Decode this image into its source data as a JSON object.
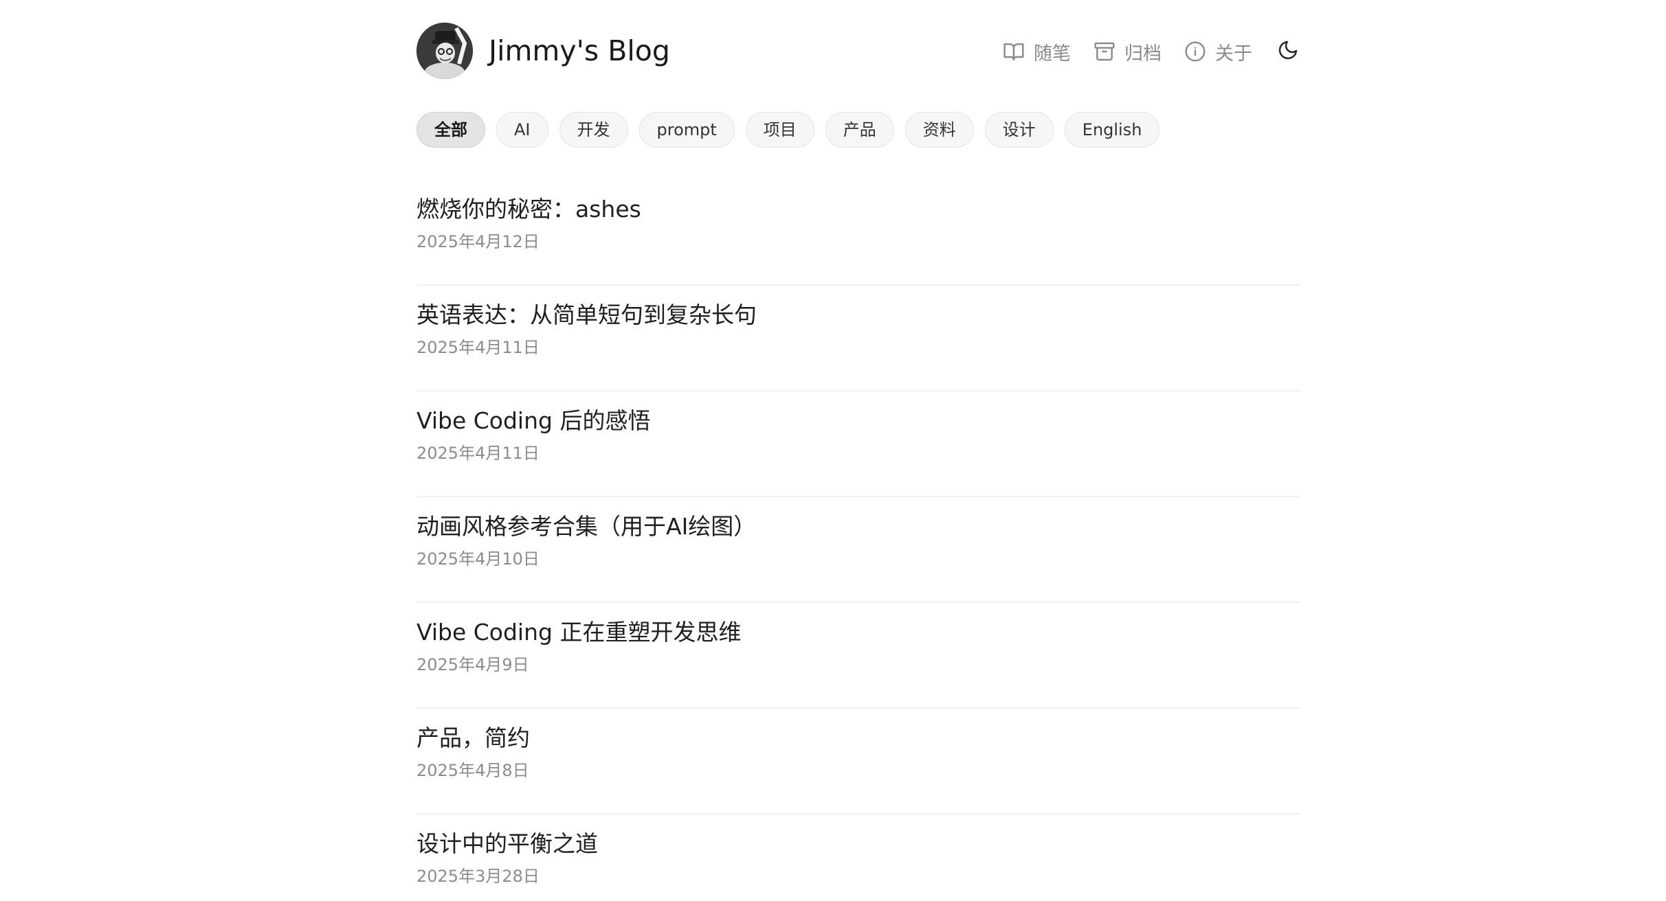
{
  "site": {
    "title": "Jimmy's Blog"
  },
  "nav": {
    "items": [
      {
        "label": "随笔",
        "icon": "book-open-icon"
      },
      {
        "label": "归档",
        "icon": "archive-icon"
      },
      {
        "label": "关于",
        "icon": "info-icon"
      }
    ],
    "theme_icon": "moon-icon"
  },
  "tags": [
    {
      "label": "全部",
      "active": true
    },
    {
      "label": "AI"
    },
    {
      "label": "开发"
    },
    {
      "label": "prompt"
    },
    {
      "label": "项目"
    },
    {
      "label": "产品"
    },
    {
      "label": "资料"
    },
    {
      "label": "设计"
    },
    {
      "label": "English"
    }
  ],
  "posts": [
    {
      "title": "燃烧你的秘密：ashes",
      "date": "2025年4月12日"
    },
    {
      "title": "英语表达：从简单短句到复杂长句",
      "date": "2025年4月11日"
    },
    {
      "title": "Vibe Coding 后的感悟",
      "date": "2025年4月11日"
    },
    {
      "title": "动画风格参考合集（用于AI绘图）",
      "date": "2025年4月10日"
    },
    {
      "title": "Vibe Coding 正在重塑开发思维",
      "date": "2025年4月9日"
    },
    {
      "title": "产品，简约",
      "date": "2025年4月8日"
    },
    {
      "title": "设计中的平衡之道",
      "date": "2025年3月28日"
    }
  ],
  "colors": {
    "text": "#1f1f1f",
    "muted": "#8c8c8c",
    "tag_bg": "#f6f6f6",
    "tag_active_bg": "#e4e4e4",
    "divider": "#f0f0f0"
  }
}
